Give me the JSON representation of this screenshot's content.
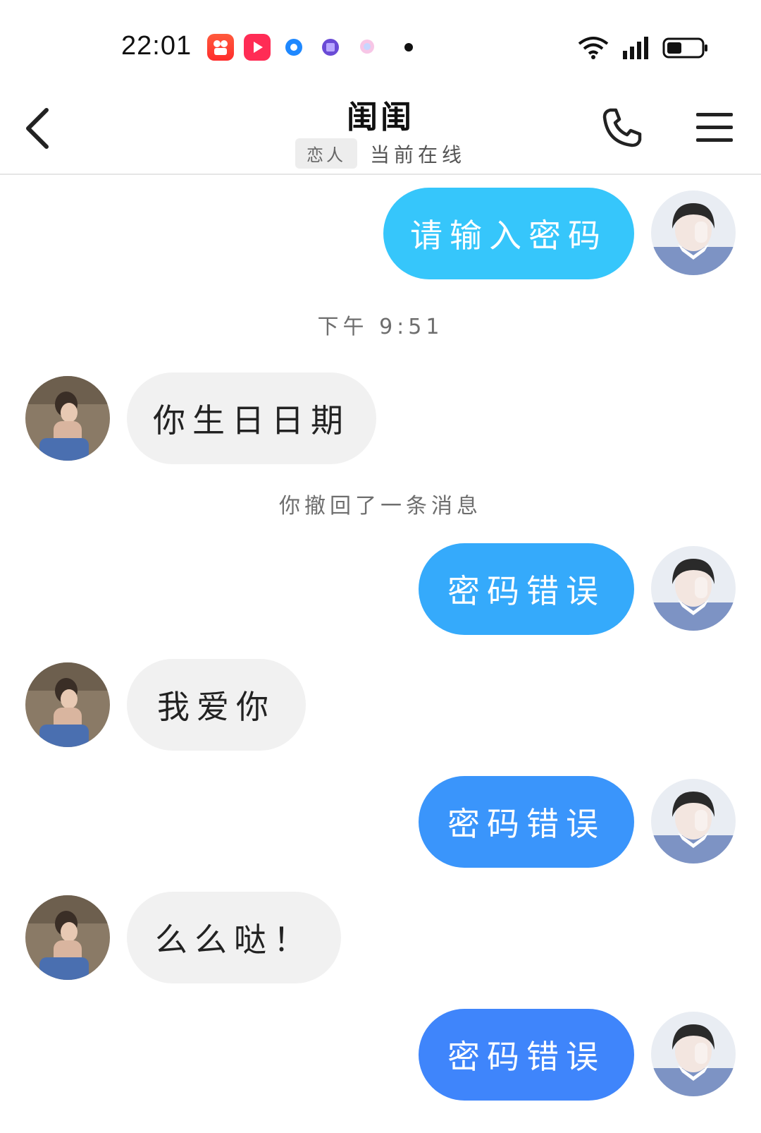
{
  "status_bar": {
    "time": "22:01"
  },
  "header": {
    "title": "闺闺",
    "relation_badge": "恋人",
    "online_status": "当前在线"
  },
  "messages": [
    {
      "side": "out",
      "text": "请输入密码",
      "color": "#36c6fb"
    },
    {
      "system": "下午 9:51"
    },
    {
      "side": "in",
      "text": "你生日日期"
    },
    {
      "system": "你撤回了一条消息"
    },
    {
      "side": "out",
      "text": "密码错误",
      "color": "#35aafb"
    },
    {
      "side": "in",
      "text": "我爱你"
    },
    {
      "side": "out",
      "text": "密码错误",
      "color": "#3a95fb"
    },
    {
      "side": "in",
      "text": "么么哒！"
    },
    {
      "side": "out",
      "text": "密码错误",
      "color": "#3f85fb"
    }
  ],
  "colors": {
    "incoming_bubble": "#f1f1f1",
    "system_text": "#6e6e6e"
  }
}
